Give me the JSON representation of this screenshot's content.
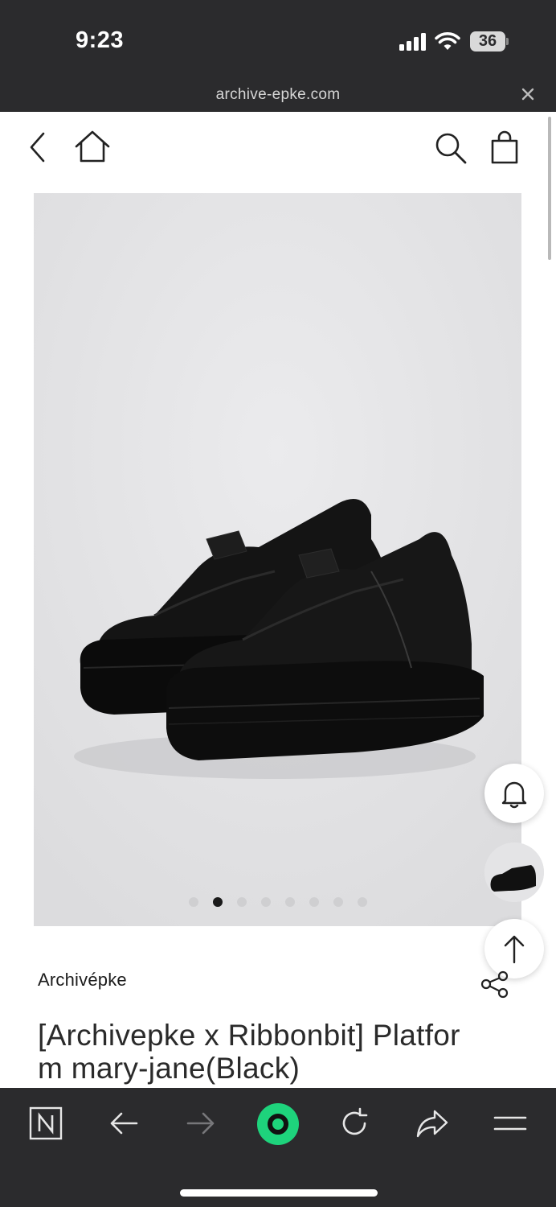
{
  "status_bar": {
    "time": "9:23",
    "battery_level": "36",
    "icons": [
      "signal-icon",
      "wifi-icon",
      "battery-icon"
    ]
  },
  "url_bar": {
    "domain": "archive-epke.com",
    "close_icon": "close-icon"
  },
  "header": {
    "icons": [
      "back-icon",
      "home-icon",
      "search-icon",
      "shopping-bag-icon"
    ]
  },
  "gallery": {
    "image_count": 8,
    "active_index": 1,
    "image_subject": "product-photo"
  },
  "floating_actions": [
    "bell-icon",
    "product-thumbnail",
    "arrow-up-icon"
  ],
  "product": {
    "brand": "Archivépke",
    "title_line1": "[Archivepke x Ribbonbit] Platfor",
    "title_line2": "m mary-jane(Black)",
    "share_icon": "share-icon"
  },
  "toolbar": {
    "icons": [
      "naver-logo-icon",
      "back-arrow-icon",
      "forward-arrow-icon",
      "green-dot-button",
      "refresh-icon",
      "share-arrow-icon",
      "menu-icon"
    ]
  },
  "colors": {
    "chrome": "#2b2b2d",
    "accent_green": "#1ed37c",
    "photo_background": "#e4e4e6"
  }
}
